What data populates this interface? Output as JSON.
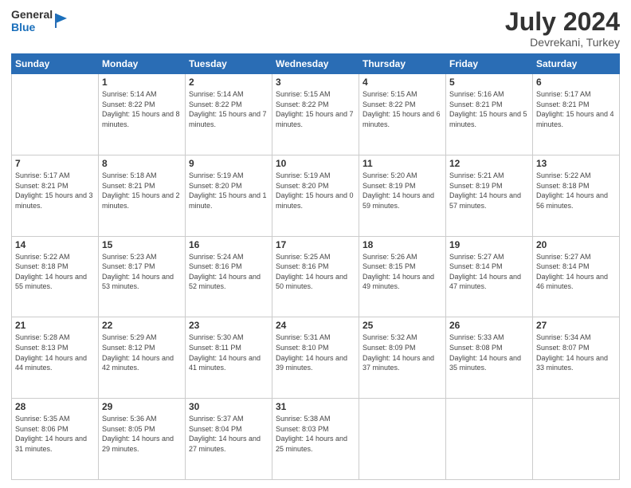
{
  "header": {
    "logo_general": "General",
    "logo_blue": "Blue",
    "title": "July 2024",
    "location": "Devrekani, Turkey"
  },
  "calendar": {
    "headers": [
      "Sunday",
      "Monday",
      "Tuesday",
      "Wednesday",
      "Thursday",
      "Friday",
      "Saturday"
    ],
    "weeks": [
      [
        {
          "day": "",
          "sunrise": "",
          "sunset": "",
          "daylight": ""
        },
        {
          "day": "1",
          "sunrise": "Sunrise: 5:14 AM",
          "sunset": "Sunset: 8:22 PM",
          "daylight": "Daylight: 15 hours and 8 minutes."
        },
        {
          "day": "2",
          "sunrise": "Sunrise: 5:14 AM",
          "sunset": "Sunset: 8:22 PM",
          "daylight": "Daylight: 15 hours and 7 minutes."
        },
        {
          "day": "3",
          "sunrise": "Sunrise: 5:15 AM",
          "sunset": "Sunset: 8:22 PM",
          "daylight": "Daylight: 15 hours and 7 minutes."
        },
        {
          "day": "4",
          "sunrise": "Sunrise: 5:15 AM",
          "sunset": "Sunset: 8:22 PM",
          "daylight": "Daylight: 15 hours and 6 minutes."
        },
        {
          "day": "5",
          "sunrise": "Sunrise: 5:16 AM",
          "sunset": "Sunset: 8:21 PM",
          "daylight": "Daylight: 15 hours and 5 minutes."
        },
        {
          "day": "6",
          "sunrise": "Sunrise: 5:17 AM",
          "sunset": "Sunset: 8:21 PM",
          "daylight": "Daylight: 15 hours and 4 minutes."
        }
      ],
      [
        {
          "day": "7",
          "sunrise": "Sunrise: 5:17 AM",
          "sunset": "Sunset: 8:21 PM",
          "daylight": "Daylight: 15 hours and 3 minutes."
        },
        {
          "day": "8",
          "sunrise": "Sunrise: 5:18 AM",
          "sunset": "Sunset: 8:21 PM",
          "daylight": "Daylight: 15 hours and 2 minutes."
        },
        {
          "day": "9",
          "sunrise": "Sunrise: 5:19 AM",
          "sunset": "Sunset: 8:20 PM",
          "daylight": "Daylight: 15 hours and 1 minute."
        },
        {
          "day": "10",
          "sunrise": "Sunrise: 5:19 AM",
          "sunset": "Sunset: 8:20 PM",
          "daylight": "Daylight: 15 hours and 0 minutes."
        },
        {
          "day": "11",
          "sunrise": "Sunrise: 5:20 AM",
          "sunset": "Sunset: 8:19 PM",
          "daylight": "Daylight: 14 hours and 59 minutes."
        },
        {
          "day": "12",
          "sunrise": "Sunrise: 5:21 AM",
          "sunset": "Sunset: 8:19 PM",
          "daylight": "Daylight: 14 hours and 57 minutes."
        },
        {
          "day": "13",
          "sunrise": "Sunrise: 5:22 AM",
          "sunset": "Sunset: 8:18 PM",
          "daylight": "Daylight: 14 hours and 56 minutes."
        }
      ],
      [
        {
          "day": "14",
          "sunrise": "Sunrise: 5:22 AM",
          "sunset": "Sunset: 8:18 PM",
          "daylight": "Daylight: 14 hours and 55 minutes."
        },
        {
          "day": "15",
          "sunrise": "Sunrise: 5:23 AM",
          "sunset": "Sunset: 8:17 PM",
          "daylight": "Daylight: 14 hours and 53 minutes."
        },
        {
          "day": "16",
          "sunrise": "Sunrise: 5:24 AM",
          "sunset": "Sunset: 8:16 PM",
          "daylight": "Daylight: 14 hours and 52 minutes."
        },
        {
          "day": "17",
          "sunrise": "Sunrise: 5:25 AM",
          "sunset": "Sunset: 8:16 PM",
          "daylight": "Daylight: 14 hours and 50 minutes."
        },
        {
          "day": "18",
          "sunrise": "Sunrise: 5:26 AM",
          "sunset": "Sunset: 8:15 PM",
          "daylight": "Daylight: 14 hours and 49 minutes."
        },
        {
          "day": "19",
          "sunrise": "Sunrise: 5:27 AM",
          "sunset": "Sunset: 8:14 PM",
          "daylight": "Daylight: 14 hours and 47 minutes."
        },
        {
          "day": "20",
          "sunrise": "Sunrise: 5:27 AM",
          "sunset": "Sunset: 8:14 PM",
          "daylight": "Daylight: 14 hours and 46 minutes."
        }
      ],
      [
        {
          "day": "21",
          "sunrise": "Sunrise: 5:28 AM",
          "sunset": "Sunset: 8:13 PM",
          "daylight": "Daylight: 14 hours and 44 minutes."
        },
        {
          "day": "22",
          "sunrise": "Sunrise: 5:29 AM",
          "sunset": "Sunset: 8:12 PM",
          "daylight": "Daylight: 14 hours and 42 minutes."
        },
        {
          "day": "23",
          "sunrise": "Sunrise: 5:30 AM",
          "sunset": "Sunset: 8:11 PM",
          "daylight": "Daylight: 14 hours and 41 minutes."
        },
        {
          "day": "24",
          "sunrise": "Sunrise: 5:31 AM",
          "sunset": "Sunset: 8:10 PM",
          "daylight": "Daylight: 14 hours and 39 minutes."
        },
        {
          "day": "25",
          "sunrise": "Sunrise: 5:32 AM",
          "sunset": "Sunset: 8:09 PM",
          "daylight": "Daylight: 14 hours and 37 minutes."
        },
        {
          "day": "26",
          "sunrise": "Sunrise: 5:33 AM",
          "sunset": "Sunset: 8:08 PM",
          "daylight": "Daylight: 14 hours and 35 minutes."
        },
        {
          "day": "27",
          "sunrise": "Sunrise: 5:34 AM",
          "sunset": "Sunset: 8:07 PM",
          "daylight": "Daylight: 14 hours and 33 minutes."
        }
      ],
      [
        {
          "day": "28",
          "sunrise": "Sunrise: 5:35 AM",
          "sunset": "Sunset: 8:06 PM",
          "daylight": "Daylight: 14 hours and 31 minutes."
        },
        {
          "day": "29",
          "sunrise": "Sunrise: 5:36 AM",
          "sunset": "Sunset: 8:05 PM",
          "daylight": "Daylight: 14 hours and 29 minutes."
        },
        {
          "day": "30",
          "sunrise": "Sunrise: 5:37 AM",
          "sunset": "Sunset: 8:04 PM",
          "daylight": "Daylight: 14 hours and 27 minutes."
        },
        {
          "day": "31",
          "sunrise": "Sunrise: 5:38 AM",
          "sunset": "Sunset: 8:03 PM",
          "daylight": "Daylight: 14 hours and 25 minutes."
        },
        {
          "day": "",
          "sunrise": "",
          "sunset": "",
          "daylight": ""
        },
        {
          "day": "",
          "sunrise": "",
          "sunset": "",
          "daylight": ""
        },
        {
          "day": "",
          "sunrise": "",
          "sunset": "",
          "daylight": ""
        }
      ]
    ]
  }
}
